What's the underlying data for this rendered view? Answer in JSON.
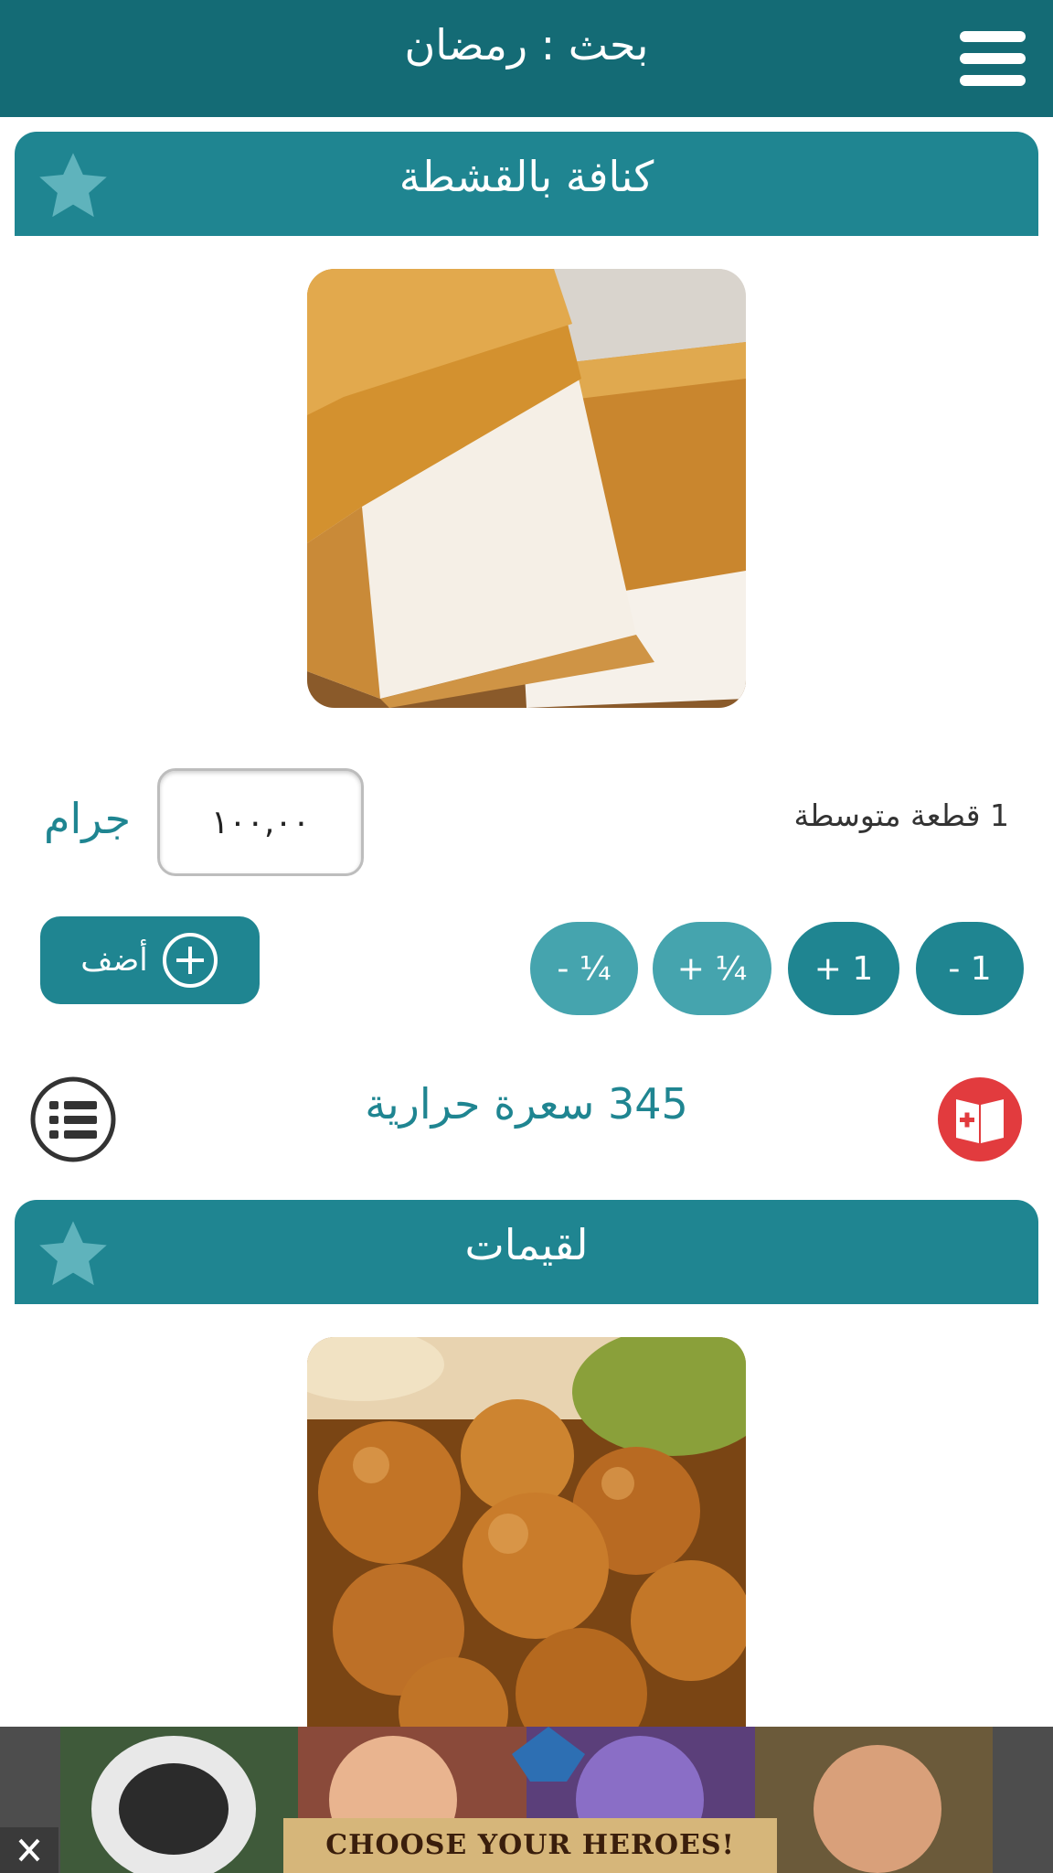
{
  "header": {
    "title": "بحث : رمضان"
  },
  "items": [
    {
      "name": "كنافة بالقشطة",
      "serving": "1 قطعة متوسطة",
      "quantity": "١٠٠,٠٠",
      "unit": "جرام",
      "steppers": [
        "- 1",
        "+ 1",
        "+ ¼",
        "- ¼"
      ],
      "add_label": "أضف",
      "calories": "345 سعرة حرارية"
    },
    {
      "name": "لقيمات"
    }
  ],
  "ad": {
    "tagline": "CHOOSE YOUR HEROES!"
  },
  "colors": {
    "primary_dark": "#146b75",
    "primary": "#1f8591",
    "primary_light": "#45a4ae",
    "accent_red": "#e23b3e"
  }
}
